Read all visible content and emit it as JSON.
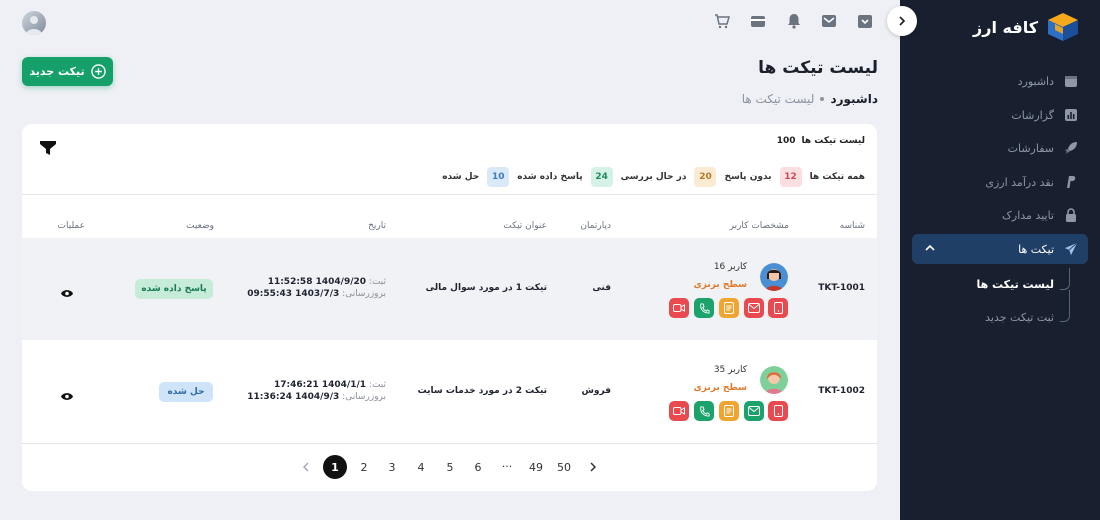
{
  "brand": {
    "name": "کافه ارز"
  },
  "sidebar": {
    "items": [
      {
        "label": "داشبورد",
        "icon": "calendar-icon"
      },
      {
        "label": "گزارشات",
        "icon": "chart-icon"
      },
      {
        "label": "سفارشات",
        "icon": "rocket-icon"
      },
      {
        "label": "نقد درآمد ارزی",
        "icon": "paypal-icon"
      },
      {
        "label": "تایید مدارک",
        "icon": "lock-icon"
      },
      {
        "label": "تیکت ها",
        "icon": "send-icon"
      }
    ],
    "sub_items": [
      {
        "label": "لیست تیکت ها"
      },
      {
        "label": "ثبت تیکت جدید"
      }
    ]
  },
  "header": {
    "new_ticket_label": "تیکت جدید",
    "page_title": "لیست تیکت ها",
    "breadcrumb_home": "داشبورد",
    "breadcrumb_current": "لیست تیکت ها"
  },
  "card": {
    "list_label": "لیست تیکت ها",
    "list_count": "100",
    "stats": [
      {
        "label": "همه تیکت ها",
        "value": ""
      },
      {
        "label": "بدون پاسخ",
        "value": "12",
        "bg": "#fbdfe0",
        "fg": "#c94a55"
      },
      {
        "label": "در حال بررسی",
        "value": "20",
        "bg": "#fbebd2",
        "fg": "#b9782a"
      },
      {
        "label": "پاسخ داده شده",
        "value": "24",
        "bg": "#d6f1e5",
        "fg": "#1d8c5d"
      },
      {
        "label": "حل شده",
        "value": "10",
        "bg": "#d9e9f8",
        "fg": "#3b7bbf"
      }
    ],
    "columns": {
      "id": "شناسه",
      "user": "مشخصات کاربر",
      "dept": "دپارتمان",
      "subject": "عنوان تیکت",
      "date": "تاریخ",
      "status": "وضعیت",
      "ops": "عملیات"
    },
    "rows": [
      {
        "id": "TKT-1001",
        "user_name": "کاربر 16",
        "user_level": "سطح برنزی",
        "dept": "فنی",
        "subject": "تیکت 1 در مورد سوال مالی",
        "created_label": "ثبت:",
        "created": "1404/9/20 11:52:58",
        "updated_label": "بروزرسانی:",
        "updated": "1403/7/3 09:55:43",
        "status": "پاسخ داده شده",
        "status_bg": "#c6ecd9",
        "status_fg": "#1a7a51"
      },
      {
        "id": "TKT-1002",
        "user_name": "کاربر 35",
        "user_level": "سطح برنزی",
        "dept": "فروش",
        "subject": "تیکت 2 در مورد خدمات سایت",
        "created_label": "ثبت:",
        "created": "1404/1/1 17:46:21",
        "updated_label": "بروزرسانی:",
        "updated": "1404/9/3 11:36:24",
        "status": "حل شده",
        "status_bg": "#cfe4f8",
        "status_fg": "#2e6ca8"
      }
    ]
  },
  "pagination": {
    "pages": [
      "1",
      "2",
      "3",
      "4",
      "5",
      "6",
      "...",
      "49",
      "50"
    ],
    "active": "1"
  },
  "colors": {
    "sidebar_bg": "#182030",
    "accent_green": "#16a069",
    "active_item_bg": "#1f3f66"
  }
}
